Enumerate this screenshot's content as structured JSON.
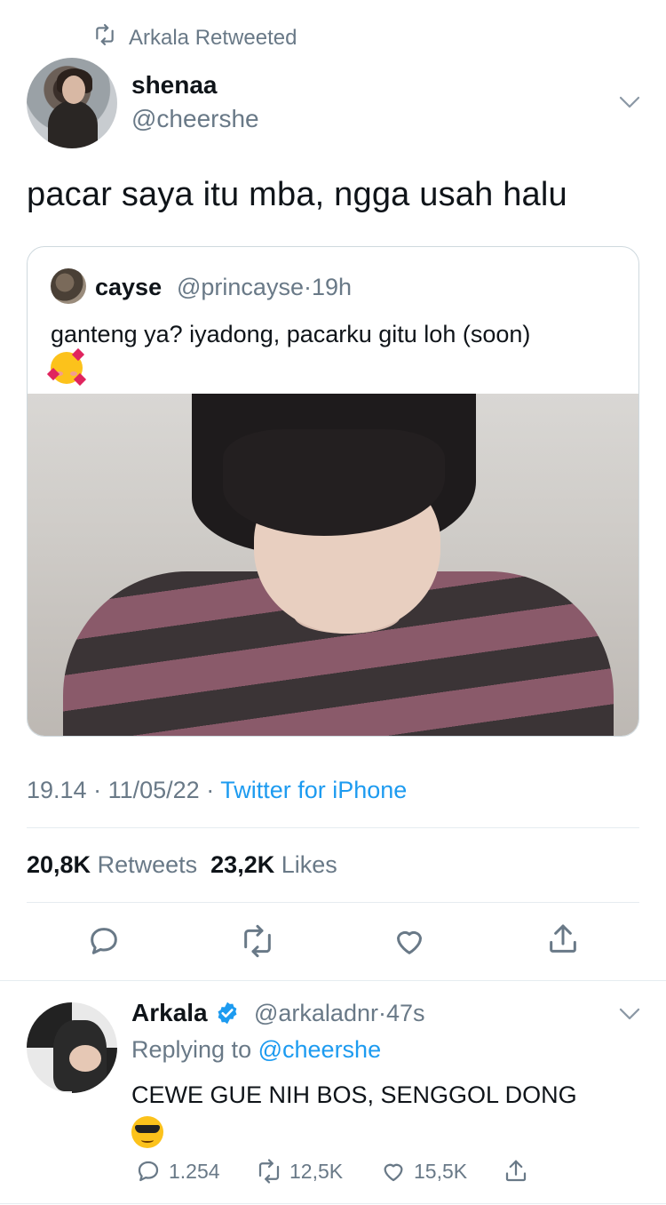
{
  "retweet_header": {
    "text": "Arkala Retweeted"
  },
  "main_tweet": {
    "display_name": "shenaa",
    "handle": "@cheershe",
    "text": "pacar saya itu mba, ngga usah halu",
    "quote": {
      "display_name": "cayse",
      "handle": "@princayse",
      "separator": "·",
      "time": "19h",
      "text": "ganteng ya? iyadong, pacarku gitu loh (soon)",
      "emoji": "smiling-face-with-hearts"
    },
    "time": "19.14",
    "date": "11/05/22",
    "source": "Twitter for iPhone",
    "retweets_count": "20,8K",
    "retweets_label": "Retweets",
    "likes_count": "23,2K",
    "likes_label": "Likes"
  },
  "reply": {
    "display_name": "Arkala",
    "handle": "@arkaladnr",
    "separator": "·",
    "time": "47s",
    "replying_prefix": "Replying to",
    "replying_handle": "@cheershe",
    "text": "CEWE GUE NIH BOS, SENGGOL DONG",
    "emoji": "smiling-face-with-sunglasses",
    "reply_count": "1.254",
    "retweet_count": "12,5K",
    "like_count": "15,5K"
  },
  "colors": {
    "accent": "#1d9bf0",
    "muted": "#697987",
    "text": "#0f1419"
  }
}
